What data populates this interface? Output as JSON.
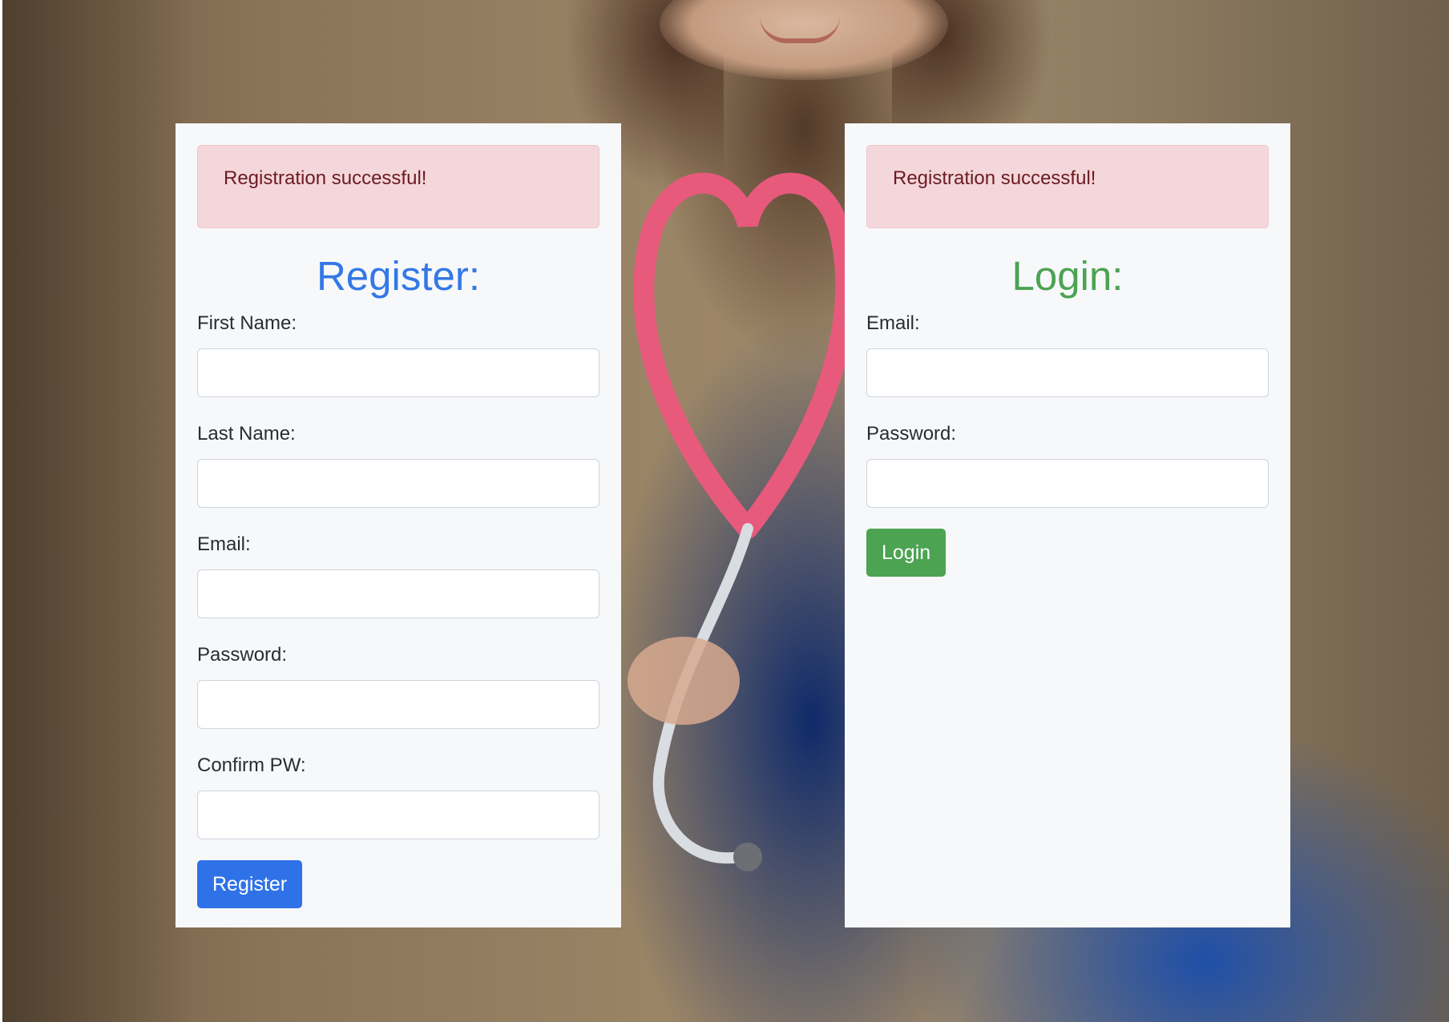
{
  "colors": {
    "register_accent": "#3478e6",
    "register_button": "#2f72e8",
    "login_accent": "#4ca352",
    "alert_background": "#f4d7da",
    "alert_text": "#6b1a22",
    "panel_background": "#f7f8fa"
  },
  "background": {
    "icon": "nurse-holding-pink-stethoscope-heart-photo"
  },
  "register": {
    "alert": "Registration successful!",
    "title": "Register:",
    "fields": [
      {
        "label": "First Name:",
        "value": ""
      },
      {
        "label": "Last Name:",
        "value": ""
      },
      {
        "label": "Email:",
        "value": ""
      },
      {
        "label": "Password:",
        "value": ""
      },
      {
        "label": "Confirm PW:",
        "value": ""
      }
    ],
    "button": "Register"
  },
  "login": {
    "alert": "Registration successful!",
    "title": "Login:",
    "fields": [
      {
        "label": "Email:",
        "value": ""
      },
      {
        "label": "Password:",
        "value": ""
      }
    ],
    "button": "Login"
  }
}
